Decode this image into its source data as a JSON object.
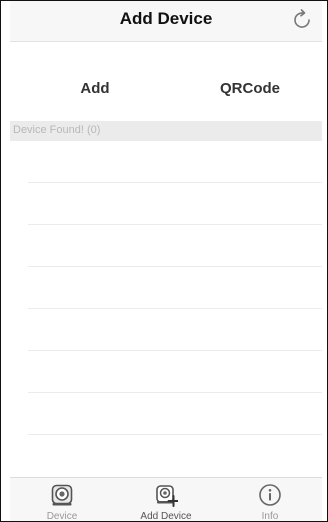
{
  "header": {
    "title": "Add Device",
    "refresh_icon": "refresh-icon"
  },
  "actions": {
    "add_label": "Add",
    "qrcode_label": "QRCode"
  },
  "section": {
    "label": "Device Found! (0)"
  },
  "tabs": [
    {
      "label": "Device",
      "icon": "camera-icon"
    },
    {
      "label": "Add Device",
      "icon": "camera-add-icon"
    },
    {
      "label": "Info",
      "icon": "info-icon"
    }
  ],
  "colors": {
    "header_bg": "#f7f7f7",
    "section_bg": "#ebebeb",
    "tab_inactive": "#999999"
  }
}
